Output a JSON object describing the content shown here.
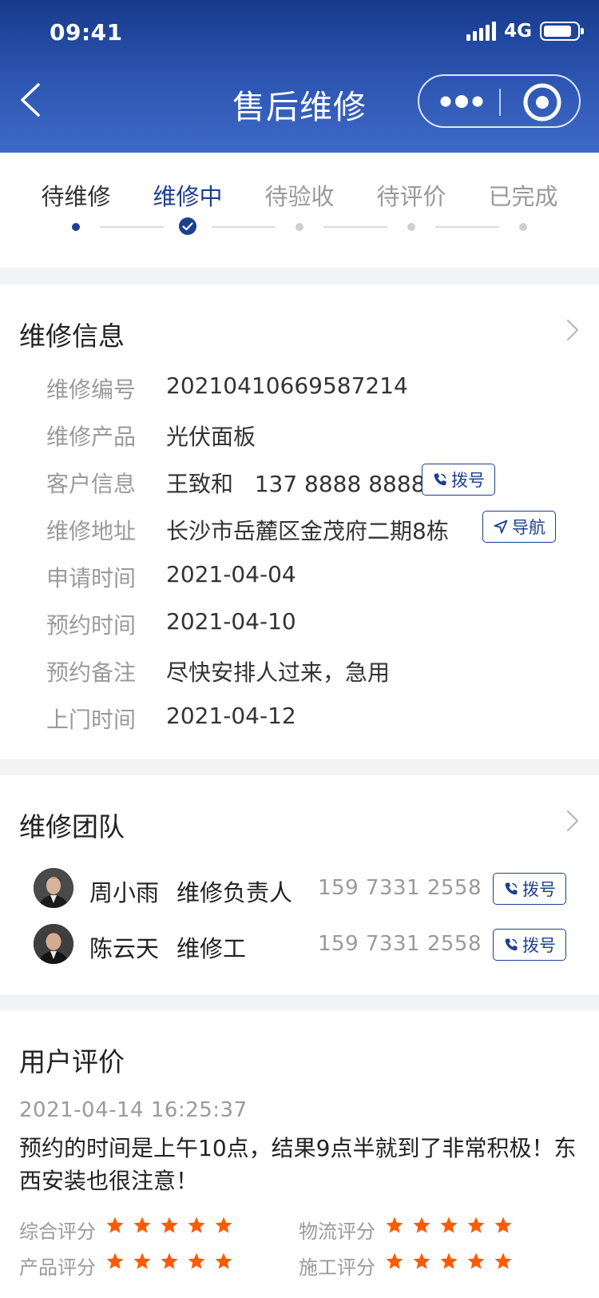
{
  "status_bar": {
    "time": "09:41",
    "network": "4G"
  },
  "nav": {
    "title": "售后维修"
  },
  "steps": [
    {
      "label": "待维修",
      "state": "done"
    },
    {
      "label": "维修中",
      "state": "active"
    },
    {
      "label": "待验收",
      "state": "pending"
    },
    {
      "label": "待评价",
      "state": "pending"
    },
    {
      "label": "已完成",
      "state": "pending"
    }
  ],
  "repair_info": {
    "title": "维修信息",
    "rows": [
      {
        "label": "维修编号",
        "value": "20210410669587214"
      },
      {
        "label": "维修产品",
        "value": "光伏面板"
      },
      {
        "label": "客户信息",
        "value": "王致和   137 8888 8888"
      },
      {
        "label": "维修地址",
        "value": "长沙市岳麓区金茂府二期8栋"
      },
      {
        "label": "申请时间",
        "value": "2021-04-04"
      },
      {
        "label": "预约时间",
        "value": "2021-04-10"
      },
      {
        "label": "预约备注",
        "value": "尽快安排人过来，急用"
      },
      {
        "label": "上门时间",
        "value": "2021-04-12"
      }
    ],
    "dial_label": "拨号",
    "nav_label": "导航"
  },
  "team": {
    "title": "维修团队",
    "members": [
      {
        "name": "周小雨",
        "role": "维修负责人",
        "phone": "159 7331 2558"
      },
      {
        "name": "陈云天",
        "role": "维修工",
        "phone": "159 7331 2558"
      }
    ],
    "dial_label": "拨号"
  },
  "review": {
    "title": "用户评价",
    "time": "2021-04-14 16:25:37",
    "text": "预约的时间是上午10点，结果9点半就到了非常积极！东西安装也很注意！",
    "ratings": [
      {
        "label": "综合评分",
        "stars": 5
      },
      {
        "label": "物流评分",
        "stars": 5
      },
      {
        "label": "产品评分",
        "stars": 5
      },
      {
        "label": "施工评分",
        "stars": 5
      }
    ]
  },
  "colors": {
    "primary": "#1e3f8f",
    "header_top": "#163a8c",
    "header_bottom": "#3f69c6",
    "star": "#ff5a00",
    "muted": "#9a9a9a"
  }
}
